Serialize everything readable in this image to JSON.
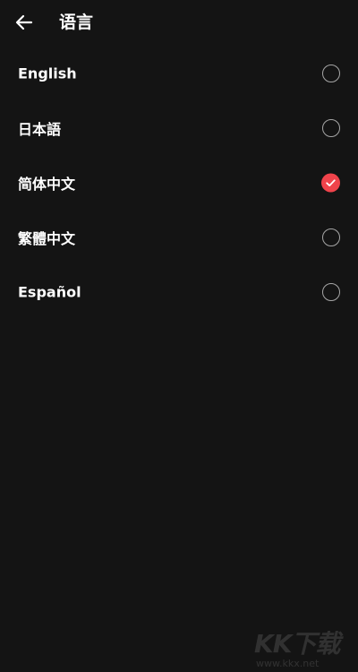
{
  "header": {
    "title": "语言",
    "back_icon": "arrow-left-icon"
  },
  "languages": [
    {
      "label": "English",
      "selected": false
    },
    {
      "label": "日本語",
      "selected": false
    },
    {
      "label": "简体中文",
      "selected": true
    },
    {
      "label": "繁體中文",
      "selected": false
    },
    {
      "label": "Español",
      "selected": false
    }
  ],
  "watermark": {
    "logo": "KK下载",
    "url": "www.kkx.net"
  },
  "colors": {
    "background": "#141414",
    "text": "#ffffff",
    "accent": "#f0434b",
    "radio_border": "#a6a6a6"
  }
}
